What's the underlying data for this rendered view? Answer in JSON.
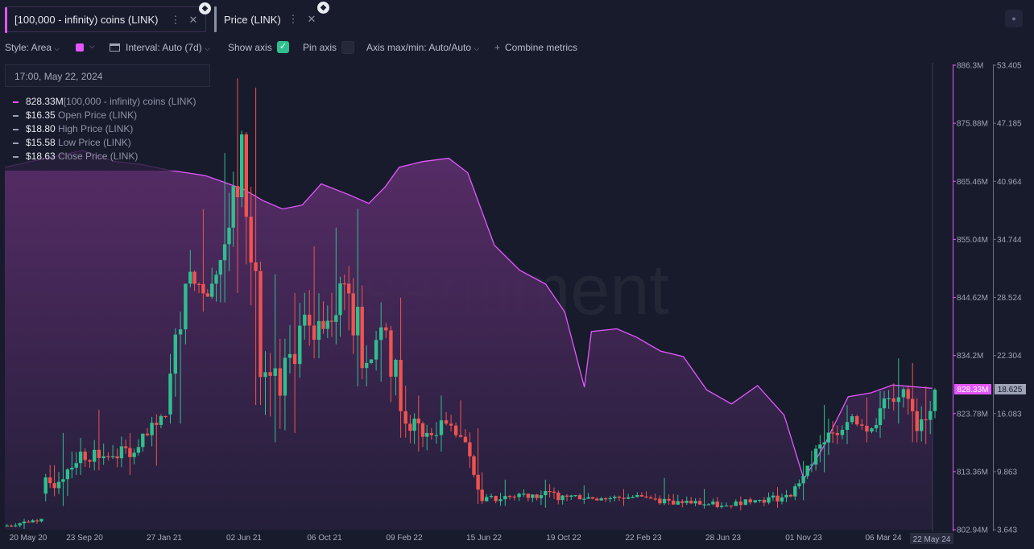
{
  "tabs": [
    {
      "label": "[100,000 - infinity) coins (LINK)",
      "color": "#e357ff"
    },
    {
      "label": "Price (LINK)",
      "color": "#8a8fa3"
    }
  ],
  "toolbar": {
    "style": "Style: Area",
    "interval": "Interval: Auto (7d)",
    "show_axis": "Show axis",
    "pin_axis": "Pin axis",
    "axis_maxmin": "Axis max/min: Auto/Auto",
    "combine": "Combine metrics",
    "metric_color": "#e357ff"
  },
  "tooltip": {
    "date": "17:00, May 22, 2024",
    "rows": [
      {
        "value": "828.33M",
        "name": "[100,000 - infinity) coins (LINK)",
        "color": "#e357ff"
      },
      {
        "value": "$16.35",
        "name": "Open Price (LINK)",
        "color": "#9aa0b3"
      },
      {
        "value": "$18.80",
        "name": "High Price (LINK)",
        "color": "#9aa0b3"
      },
      {
        "value": "$15.58",
        "name": "Low Price (LINK)",
        "color": "#9aa0b3"
      },
      {
        "value": "$18.63",
        "name": "Close Price (LINK)",
        "color": "#9aa0b3"
      }
    ]
  },
  "watermark": "santiment",
  "chart_data": {
    "type": "area+candlestick",
    "x_labels": [
      "20 May 20",
      "23 Sep 20",
      "27 Jan 21",
      "02 Jun 21",
      "06 Oct 21",
      "09 Feb 22",
      "15 Jun 22",
      "19 Oct 22",
      "22 Feb 23",
      "28 Jun 23",
      "01 Nov 23",
      "06 Mar 24",
      "22 May 24"
    ],
    "last_x_label": "22 May 24",
    "left_axis": {
      "name": "[100,000 - infinity) coins (LINK)",
      "ticks": [
        "886.3M",
        "875.88M",
        "865.46M",
        "855.04M",
        "844.62M",
        "834.2M",
        "823.78M",
        "813.36M",
        "802.94M"
      ],
      "range": [
        802.94,
        886.3
      ],
      "current": "828.33M",
      "color": "#e357ff"
    },
    "right_axis": {
      "name": "Price (LINK)",
      "ticks": [
        "53.405",
        "47.185",
        "40.964",
        "34.744",
        "28.524",
        "22.304",
        "16.083",
        "9.863",
        "3.643"
      ],
      "range": [
        3.643,
        53.405
      ],
      "current": "18.625"
    },
    "area_series": {
      "name": "[100,000 - infinity) coins (LINK)",
      "x": [
        "2020-05-20",
        "2020-07-20",
        "2020-09-20",
        "2020-11-10",
        "2020-12-20",
        "2021-02-01",
        "2021-04-01",
        "2021-05-01",
        "2021-06-01",
        "2021-07-01",
        "2021-08-01",
        "2021-09-01",
        "2021-10-01",
        "2021-11-15",
        "2021-12-15",
        "2022-01-10",
        "2022-02-01",
        "2022-03-10",
        "2022-04-20",
        "2022-05-20",
        "2022-07-01",
        "2022-08-10",
        "2022-09-20",
        "2022-10-20",
        "2022-11-20",
        "2022-12-01",
        "2023-01-10",
        "2023-02-10",
        "2023-03-20",
        "2023-04-25",
        "2023-06-01",
        "2023-07-10",
        "2023-08-20",
        "2023-10-01",
        "2023-11-01",
        "2023-12-01",
        "2024-01-10",
        "2024-02-15",
        "2024-03-20",
        "2024-05-22"
      ],
      "values": [
        868.0,
        869.5,
        871.0,
        869.0,
        868.5,
        867.5,
        866.5,
        865.3,
        864.0,
        862.0,
        860.5,
        861.2,
        865.0,
        863.0,
        861.5,
        864.5,
        868.0,
        869.0,
        869.6,
        867.0,
        854.0,
        849.5,
        847.0,
        842.0,
        828.5,
        838.5,
        839.0,
        837.5,
        835.0,
        834.0,
        828.0,
        825.5,
        828.8,
        823.5,
        812.0,
        817.6,
        826.8,
        827.5,
        828.9,
        828.33
      ],
      "color": "#e357ff",
      "fill": "#5a2d6a"
    },
    "candles": {
      "name": "Price (LINK)",
      "up_color": "#2fbf8f",
      "down_color": "#ef5350",
      "x": [
        "2020-05-20",
        "2020-07-20",
        "2020-09-20",
        "2020-11-10",
        "2020-12-20",
        "2021-02-01",
        "2021-03-05",
        "2021-04-15",
        "2021-05-12",
        "2021-06-01",
        "2021-07-01",
        "2021-08-01",
        "2021-09-01",
        "2021-10-01",
        "2021-11-10",
        "2021-12-15",
        "2022-01-15",
        "2022-02-15",
        "2022-03-20",
        "2022-04-20",
        "2022-05-20",
        "2022-06-15",
        "2022-08-20",
        "2022-10-20",
        "2022-12-20",
        "2023-02-22",
        "2023-04-20",
        "2023-06-28",
        "2023-08-20",
        "2023-10-15",
        "2023-11-10",
        "2023-12-20",
        "2024-01-20",
        "2024-02-20",
        "2024-03-10",
        "2024-04-10",
        "2024-05-01",
        "2024-05-22"
      ],
      "open": [
        4.0,
        7.5,
        12.0,
        11.5,
        12.5,
        16.0,
        30.0,
        30.0,
        36.0,
        46.0,
        20.0,
        18.0,
        25.5,
        26.0,
        30.0,
        21.5,
        25.0,
        15.0,
        14.0,
        15.0,
        13.0,
        6.7,
        7.5,
        7.3,
        7.0,
        7.2,
        6.7,
        6.2,
        6.8,
        7.2,
        10.5,
        14.0,
        15.8,
        14.5,
        17.7,
        18.7,
        14.2,
        16.35
      ],
      "high": [
        4.8,
        14.0,
        16.5,
        14.0,
        16.0,
        27.0,
        38.0,
        44.0,
        52.0,
        51.0,
        31.0,
        29.0,
        34.0,
        36.0,
        38.0,
        28.0,
        28.5,
        18.0,
        18.0,
        17.5,
        14.5,
        9.0,
        9.0,
        8.4,
        8.0,
        9.2,
        8.0,
        7.2,
        8.2,
        11.0,
        17.0,
        17.0,
        17.8,
        18.5,
        22.0,
        21.5,
        19.0,
        18.8
      ],
      "low": [
        3.7,
        6.2,
        10.0,
        9.5,
        10.5,
        15.0,
        27.0,
        28.0,
        29.0,
        17.0,
        13.0,
        14.0,
        22.0,
        23.5,
        19.0,
        19.5,
        13.5,
        12.0,
        12.0,
        13.5,
        6.4,
        6.2,
        6.0,
        6.4,
        6.2,
        6.3,
        5.9,
        5.7,
        6.0,
        6.8,
        9.8,
        12.8,
        13.0,
        13.5,
        15.0,
        13.0,
        12.8,
        15.58
      ],
      "close": [
        4.8,
        12.0,
        11.5,
        12.5,
        15.8,
        30.0,
        30.0,
        36.0,
        46.0,
        20.0,
        18.0,
        25.5,
        26.0,
        30.0,
        21.5,
        25.0,
        15.0,
        14.0,
        15.0,
        13.0,
        6.7,
        7.5,
        7.3,
        7.0,
        7.2,
        6.7,
        6.2,
        6.8,
        7.2,
        10.5,
        14.0,
        15.8,
        14.5,
        17.7,
        18.7,
        14.2,
        16.35,
        18.63
      ]
    }
  }
}
